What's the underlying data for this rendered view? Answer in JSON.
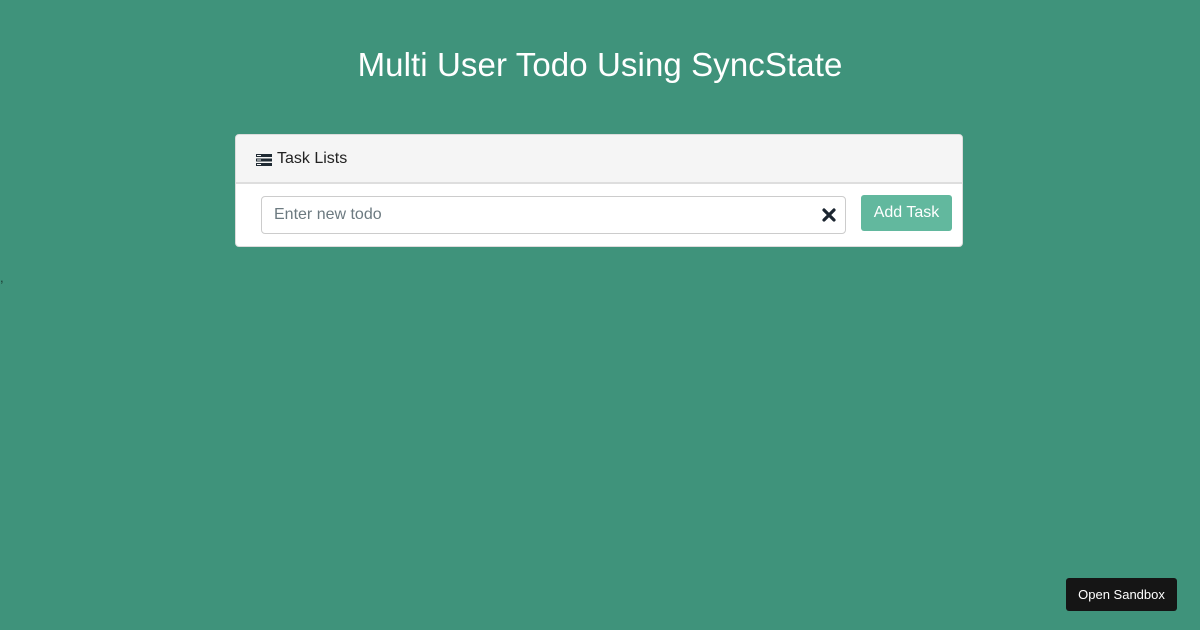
{
  "page": {
    "title": "Multi User Todo Using SyncState",
    "background_color": "#3f937b"
  },
  "panel": {
    "heading_icon": "list-icon",
    "heading_label": "Task Lists",
    "input": {
      "value": "",
      "placeholder": "Enter new todo",
      "clear_icon": "close-icon"
    },
    "add_button_label": "Add Task",
    "add_button_color": "#62b89e"
  },
  "stray_text": ",",
  "sandbox_button_label": "Open Sandbox"
}
